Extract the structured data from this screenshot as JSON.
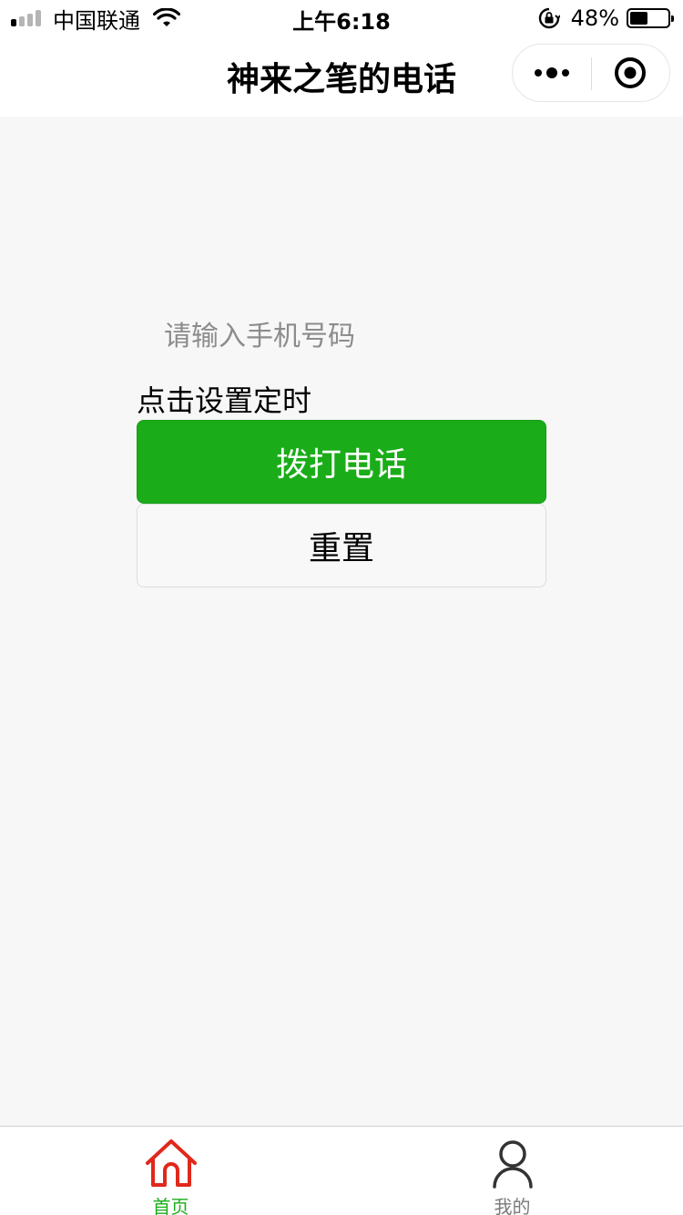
{
  "status_bar": {
    "carrier": "中国联通",
    "time": "上午6:18",
    "battery_percent": "48%",
    "battery_level": 0.48,
    "signal_bars_filled": 1,
    "signal_bars_total": 4
  },
  "nav": {
    "title": "神来之笔的电话",
    "more_icon": "more-dots-icon",
    "close_icon": "target-close-icon"
  },
  "main": {
    "phone_placeholder": "请输入手机号码",
    "timer_label": "点击设置定时",
    "call_button": "拨打电话",
    "reset_button": "重置"
  },
  "tab_bar": {
    "items": [
      {
        "label": "首页",
        "icon": "home-icon",
        "active": true
      },
      {
        "label": "我的",
        "icon": "user-icon",
        "active": false
      }
    ]
  },
  "colors": {
    "accent_green": "#1aad19",
    "home_icon_red": "#e0281b",
    "inactive_gray": "#7a7a7a",
    "background": "#f7f7f7"
  }
}
